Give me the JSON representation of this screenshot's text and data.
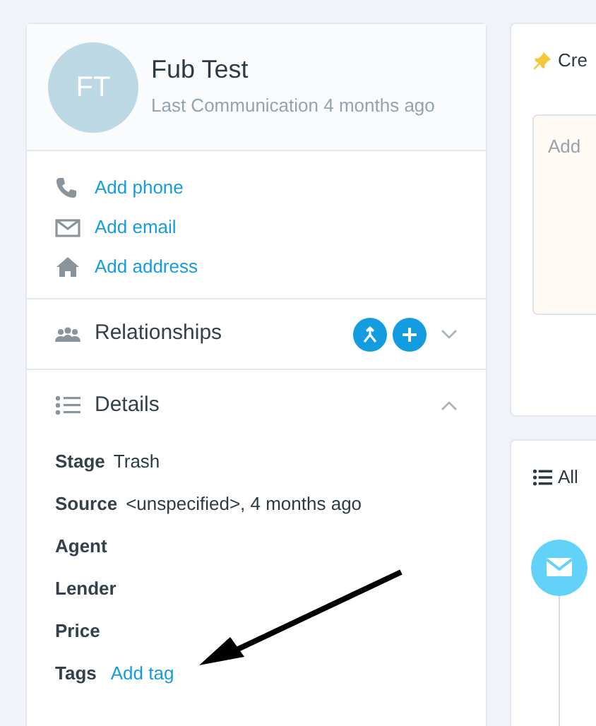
{
  "contact": {
    "initials": "FT",
    "name": "Fub Test",
    "subtitle": "Last Communication 4 months ago"
  },
  "contact_links": [
    {
      "kind": "phone",
      "label": "Add phone"
    },
    {
      "kind": "email",
      "label": "Add email"
    },
    {
      "kind": "address",
      "label": "Add address"
    }
  ],
  "relationships": {
    "title": "Relationships",
    "expanded": false
  },
  "details": {
    "title": "Details",
    "expanded": true,
    "fields": [
      {
        "label": "Stage",
        "value": "Trash",
        "kind": "text"
      },
      {
        "label": "Source",
        "value": "<unspecified>, 4 months ago",
        "kind": "text"
      },
      {
        "label": "Agent"
      },
      {
        "label": "Lender"
      },
      {
        "label": "Price"
      },
      {
        "label": "Tags",
        "value": "Add tag",
        "kind": "link"
      }
    ]
  },
  "note": {
    "title": "Cre",
    "placeholder": "Add"
  },
  "activity": {
    "filter": "All"
  }
}
